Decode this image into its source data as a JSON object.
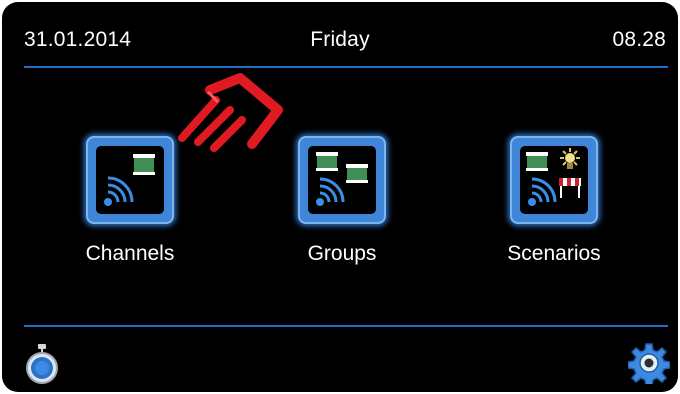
{
  "header": {
    "date": "31.01.2014",
    "day": "Friday",
    "time": "08.28"
  },
  "tiles": [
    {
      "label": "Channels",
      "icon": "channels-icon"
    },
    {
      "label": "Groups",
      "icon": "groups-icon"
    },
    {
      "label": "Scenarios",
      "icon": "scenarios-icon"
    }
  ],
  "footer": {
    "left_icon": "stopwatch-icon",
    "right_icon": "gear-icon"
  },
  "colors": {
    "background": "#000000",
    "accent_line": "#1f6fc4",
    "tile_blue": "#3f86d8",
    "blind_green": "#3f8f56",
    "pointer_red": "#e01a22"
  }
}
